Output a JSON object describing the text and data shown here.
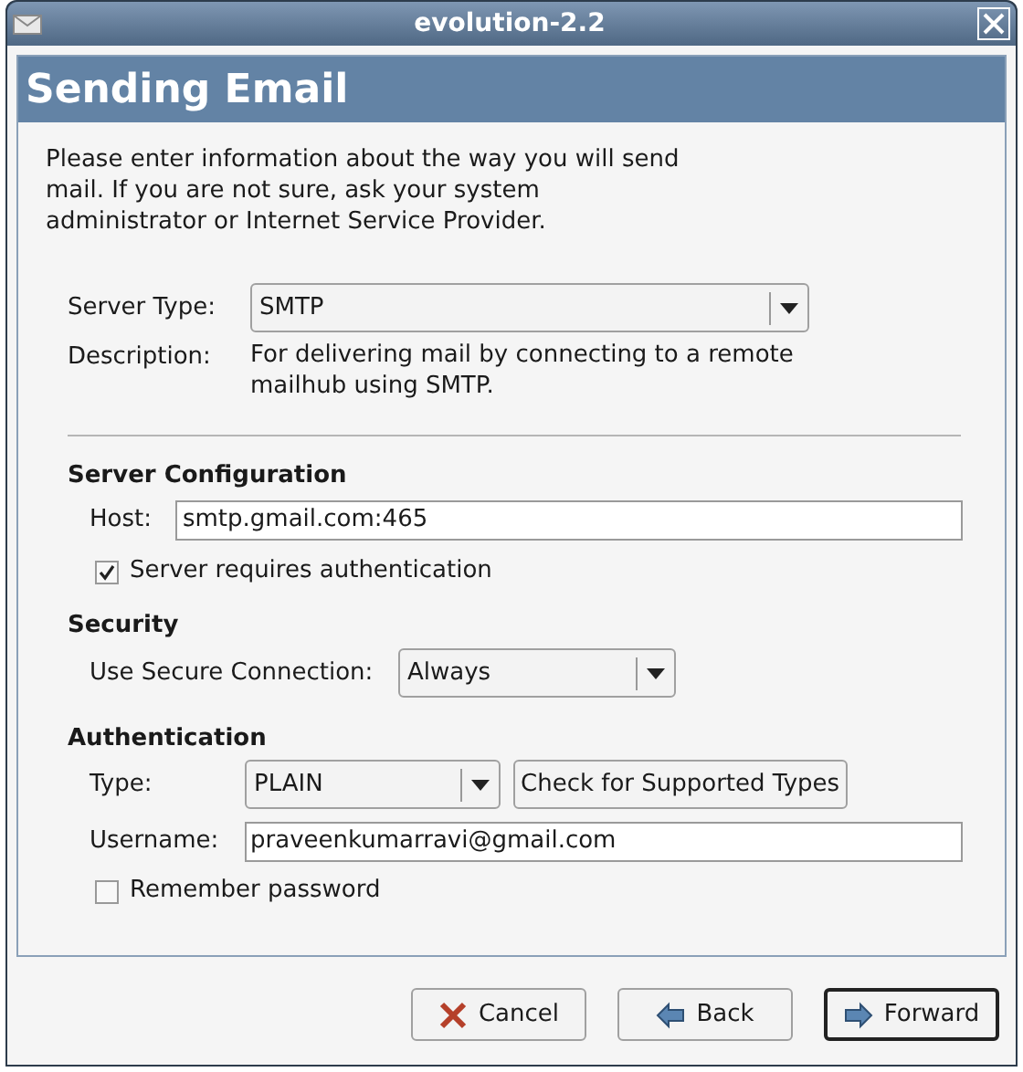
{
  "window": {
    "title": "evolution-2.2"
  },
  "page_title": "Sending Email",
  "intro": "Please enter information about the way you will send mail. If you are not sure, ask your system administrator or Internet Service Provider.",
  "server_type": {
    "label": "Server Type:",
    "value": "SMTP"
  },
  "description": {
    "label": "Description:",
    "text": "For delivering mail by connecting to a remote mailhub using SMTP."
  },
  "server_configuration": {
    "heading": "Server Configuration",
    "host_label": "Host:",
    "host_value": "smtp.gmail.com:465",
    "requires_auth": {
      "label": "Server requires authentication",
      "checked": true
    }
  },
  "security": {
    "heading": "Security",
    "label": "Use Secure Connection:",
    "value": "Always"
  },
  "authentication": {
    "heading": "Authentication",
    "type_label": "Type:",
    "type_value": "PLAIN",
    "check_button": "Check for Supported Types",
    "username_label": "Username:",
    "username_value": "praveenkumarravi@gmail.com",
    "remember": {
      "label": "Remember password",
      "checked": false
    }
  },
  "buttons": [
    {
      "kind": "cancel",
      "label": "Cancel",
      "default": false
    },
    {
      "kind": "back",
      "label": "Back",
      "default": false
    },
    {
      "kind": "forward",
      "label": "Forward",
      "default": true
    }
  ]
}
